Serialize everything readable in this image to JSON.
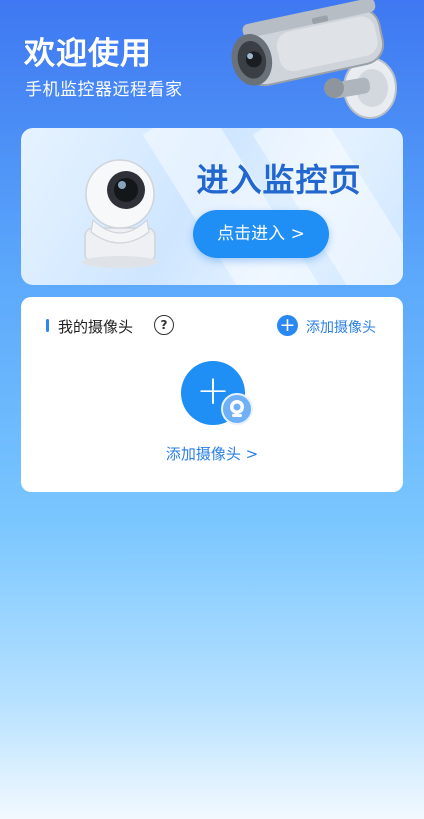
{
  "header": {
    "title": "欢迎使用",
    "subtitle": "手机监控器远程看家",
    "illustration": "cctv-camera-icon"
  },
  "monitor_card": {
    "title": "进入监控页",
    "button_label": "点击进入 >",
    "illustration": "dome-camera-icon"
  },
  "camera_section": {
    "title": "我的摄像头",
    "help_icon": "question-circle-icon",
    "help_glyph": "?",
    "add_link": "添加摄像头",
    "add_glyph": "+",
    "add_large_label": "添加摄像头 >"
  },
  "colors": {
    "accent": "#1f8ef5",
    "title_blue": "#2266cf",
    "link_blue": "#2a7fe6"
  }
}
